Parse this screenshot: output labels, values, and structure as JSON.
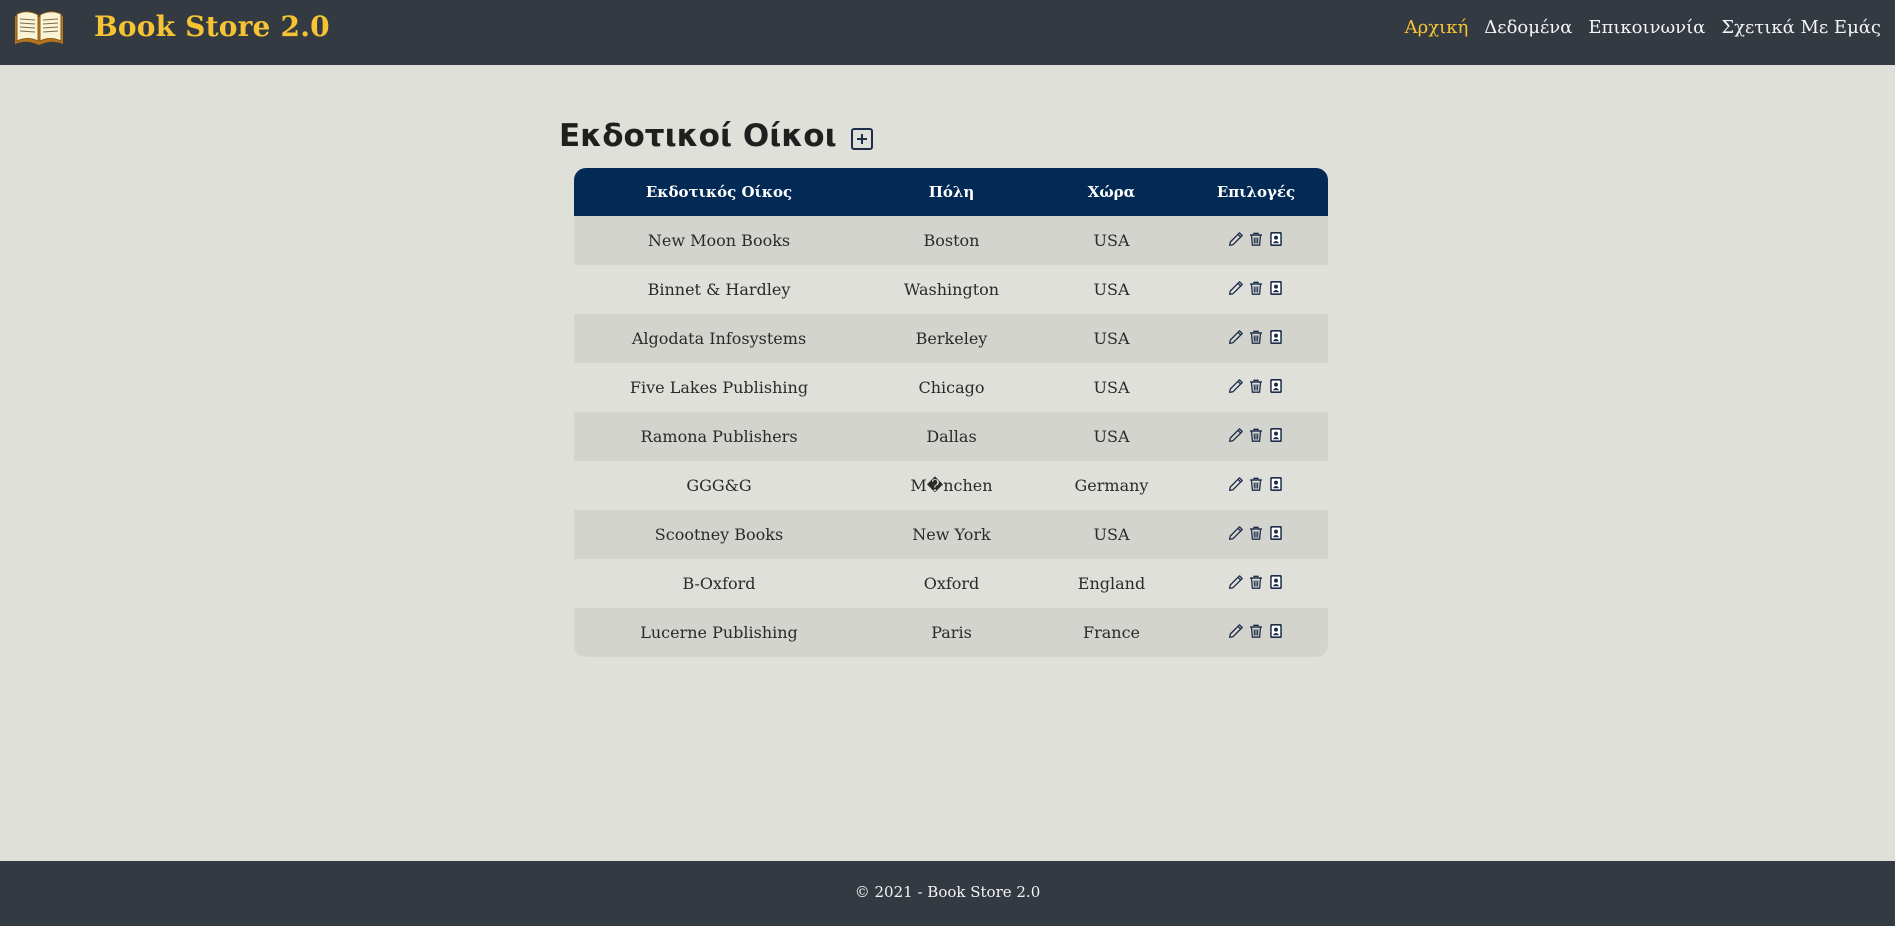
{
  "header": {
    "brand_title": "Book Store 2.0",
    "nav": [
      {
        "label": "Αρχική",
        "active": true
      },
      {
        "label": "Δεδομένα",
        "active": false
      },
      {
        "label": "Επικοινωνία",
        "active": false
      },
      {
        "label": "Σχετικά Με Εμάς",
        "active": false
      }
    ]
  },
  "main": {
    "page_title": "Εκδοτικοί Οίκοι",
    "table": {
      "columns": [
        "Εκδοτικός Οίκος",
        "Πόλη",
        "Χώρα",
        "Επιλογές"
      ],
      "rows": [
        {
          "publisher": "New Moon Books",
          "city": "Boston",
          "country": "USA"
        },
        {
          "publisher": "Binnet & Hardley",
          "city": "Washington",
          "country": "USA"
        },
        {
          "publisher": "Algodata Infosystems",
          "city": "Berkeley",
          "country": "USA"
        },
        {
          "publisher": "Five Lakes Publishing",
          "city": "Chicago",
          "country": "USA"
        },
        {
          "publisher": "Ramona Publishers",
          "city": "Dallas",
          "country": "USA"
        },
        {
          "publisher": "GGG&G",
          "city": "M�nchen",
          "country": "Germany"
        },
        {
          "publisher": "Scootney Books",
          "city": "New York",
          "country": "USA"
        },
        {
          "publisher": "B-Oxford",
          "city": "Oxford",
          "country": "England"
        },
        {
          "publisher": "Lucerne Publishing",
          "city": "Paris",
          "country": "France"
        }
      ],
      "row_actions": [
        "pencil-icon",
        "trash-icon",
        "contact-card-icon"
      ]
    }
  },
  "footer": {
    "text": "© 2021 - Book Store 2.0"
  },
  "colors": {
    "navbar_bg": "#343a42",
    "brand_accent": "#f6c433",
    "table_header_bg": "#022a54",
    "page_bg": "#dfe0da",
    "row_stripe": "#d3d4ce"
  }
}
